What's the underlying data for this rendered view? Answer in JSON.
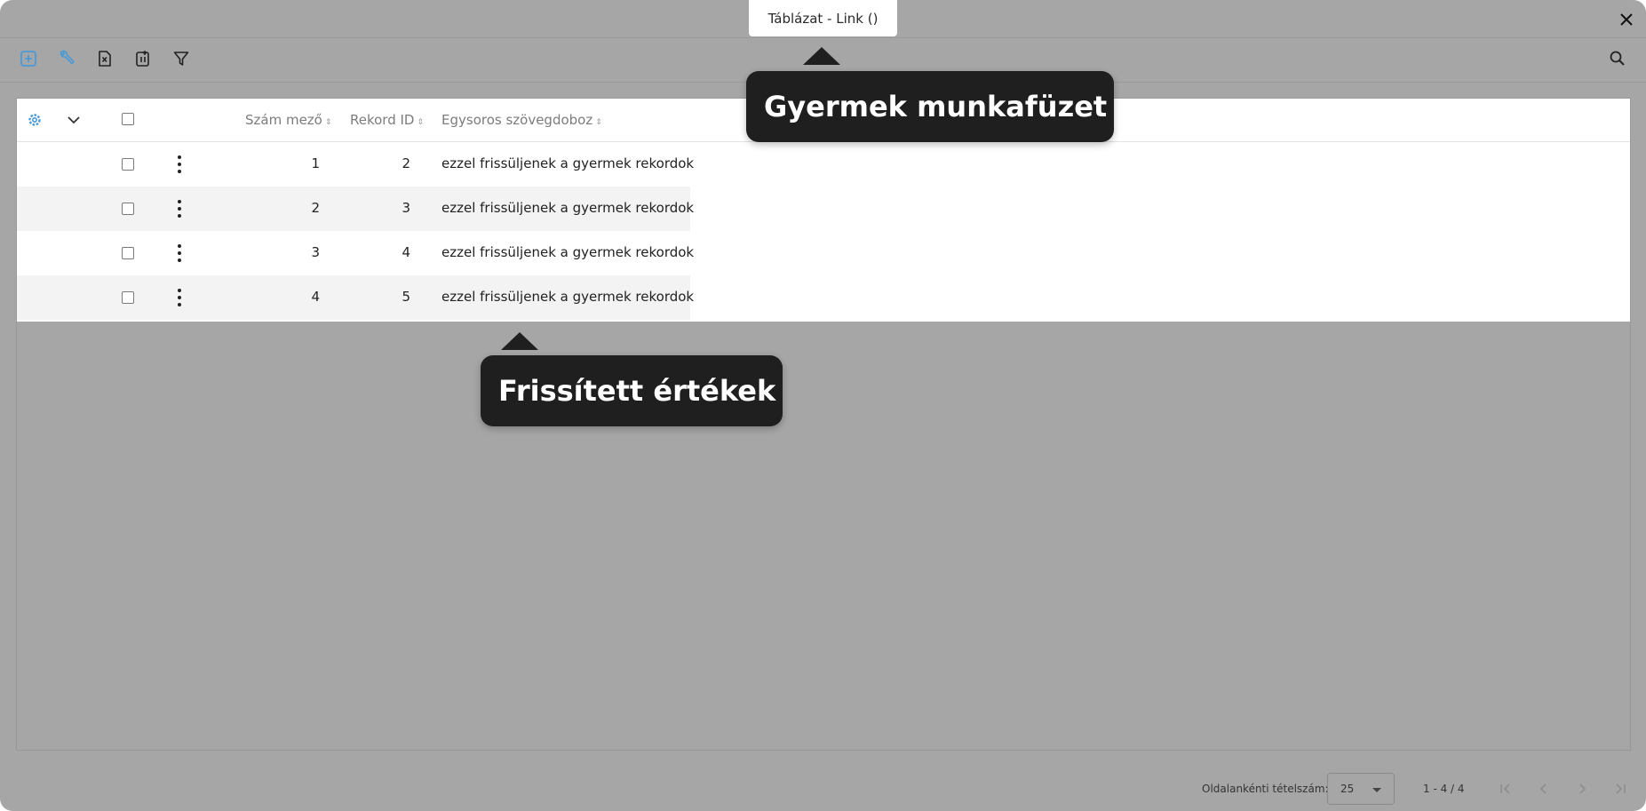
{
  "dialog": {
    "title": "Táblázat - Link ()"
  },
  "table": {
    "columns": [
      {
        "label": "Szám mező"
      },
      {
        "label": "Rekord ID"
      },
      {
        "label": "Egysoros szövegdoboz"
      }
    ],
    "rows": [
      {
        "szam": "1",
        "rekord_id": "2",
        "szoveg": "ezzel frissüljenek a gyermek rekordok"
      },
      {
        "szam": "2",
        "rekord_id": "3",
        "szoveg": "ezzel frissüljenek a gyermek rekordok"
      },
      {
        "szam": "3",
        "rekord_id": "4",
        "szoveg": "ezzel frissüljenek a gyermek rekordok"
      },
      {
        "szam": "4",
        "rekord_id": "5",
        "szoveg": "ezzel frissüljenek a gyermek rekordok"
      }
    ]
  },
  "tooltips": {
    "child_workbook": "Gyermek munkafüzet",
    "updated_values": "Frissített értékek"
  },
  "footer": {
    "page_size_label": "Oldalankénti tételszám:",
    "page_size_value": "25",
    "range_text": "1 - 4 / 4"
  },
  "icons": {
    "add": "add-icon",
    "settings": "wrench-icon",
    "export": "excel-export-icon",
    "import": "import-icon",
    "filter": "filter-icon",
    "search": "search-icon",
    "close": "close-icon",
    "column_settings": "gear-icon",
    "expand": "chevron-down-icon"
  },
  "colors": {
    "accent": "#4a9ad8",
    "overlay": "#a6a6a6",
    "tooltip_bg": "#1f1f1f"
  }
}
